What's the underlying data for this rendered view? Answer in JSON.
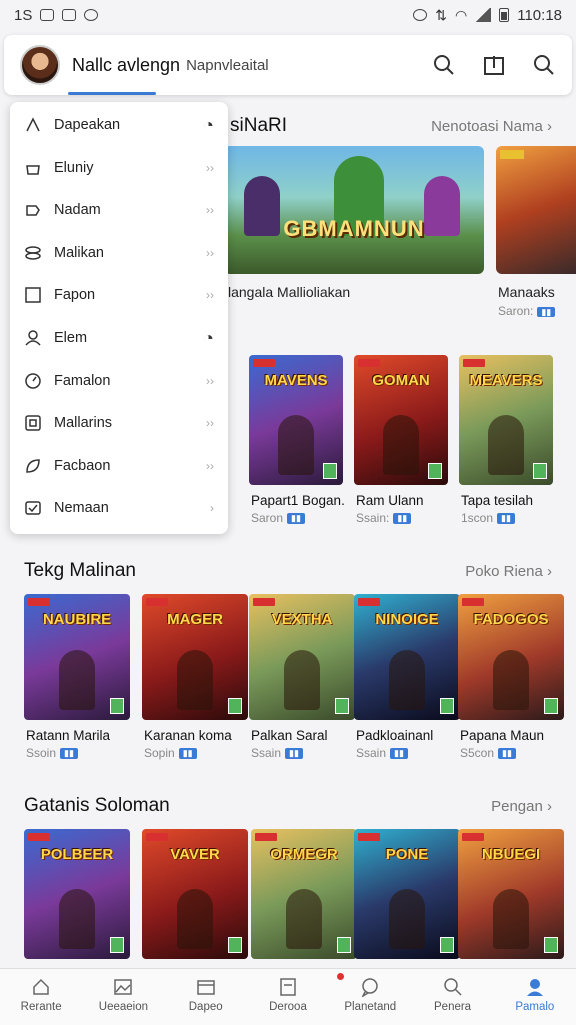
{
  "status_bar": {
    "time_left": "1S",
    "time_right": "110:18"
  },
  "header": {
    "title": "Nallc avlengn",
    "subtitle": "Napnvleaital"
  },
  "menu": {
    "items": [
      {
        "label": "Dapeakan",
        "icon": "triangle-icon"
      },
      {
        "label": "Eluniy",
        "icon": "bag-icon"
      },
      {
        "label": "Nadam",
        "icon": "puzzle-icon"
      },
      {
        "label": "Malikan",
        "icon": "layers-icon"
      },
      {
        "label": "Fapon",
        "icon": "square-icon"
      },
      {
        "label": "Elem",
        "icon": "person-icon"
      },
      {
        "label": "Famalon",
        "icon": "clock-icon"
      },
      {
        "label": "Mallarins",
        "icon": "frame-icon"
      },
      {
        "label": "Facbaon",
        "icon": "leaf-icon"
      },
      {
        "label": "Nemaan",
        "icon": "check-box-icon"
      }
    ]
  },
  "section1": {
    "title": "siNaRI",
    "more": "Nenotoasi Nama",
    "banner_logo": "GBMAMNUN",
    "banner_caption": "langala Mallioliakan",
    "side_name": "Manaaks",
    "side_sub": "Saron:"
  },
  "row2": [
    {
      "name": "Papart1 Bogan.",
      "sub": "Saron",
      "cover": "MAVENS"
    },
    {
      "name": "Ram Ulann",
      "sub": "Ssain:",
      "cover": "GOMAN"
    },
    {
      "name": "Tapa tesilah",
      "sub": "1scon",
      "cover": "MEAVERS"
    }
  ],
  "section2": {
    "title": "Tekg Malinan",
    "more": "Poko Riena"
  },
  "row3": [
    {
      "name": "Ratann Marila",
      "sub": "Ssoin",
      "cover": "NAUBIRE"
    },
    {
      "name": "Karanan koma",
      "sub": "Sopin",
      "cover": "MAGER"
    },
    {
      "name": "Palkan Saral",
      "sub": "Ssain",
      "cover": "VEXTHA"
    },
    {
      "name": "Padkloainanl",
      "sub": "Ssain",
      "cover": "NINOIGE"
    },
    {
      "name": "Papana Maun",
      "sub": "S5con",
      "cover": "FADOGOS"
    }
  ],
  "section3": {
    "title": "Gatanis Soloman",
    "more": "Pengan"
  },
  "row4": [
    {
      "cover": "POLBEER"
    },
    {
      "cover": "VAVER"
    },
    {
      "cover": "ORMEGR"
    },
    {
      "cover": "PONE"
    },
    {
      "cover": "NBUEGI"
    }
  ],
  "tabs": [
    {
      "label": "Rerante",
      "icon": "home-icon"
    },
    {
      "label": "Ueeaeion",
      "icon": "image-icon"
    },
    {
      "label": "Dapeo",
      "icon": "box-icon"
    },
    {
      "label": "Derooa",
      "icon": "document-icon"
    },
    {
      "label": "Planetand",
      "icon": "chat-icon"
    },
    {
      "label": "Penera",
      "icon": "search-icon"
    },
    {
      "label": "Pamalo",
      "icon": "profile-icon"
    }
  ],
  "colors": {
    "accent": "#3a7bd5",
    "badge_red": "#d83030",
    "badge_green": "#52b45a"
  }
}
